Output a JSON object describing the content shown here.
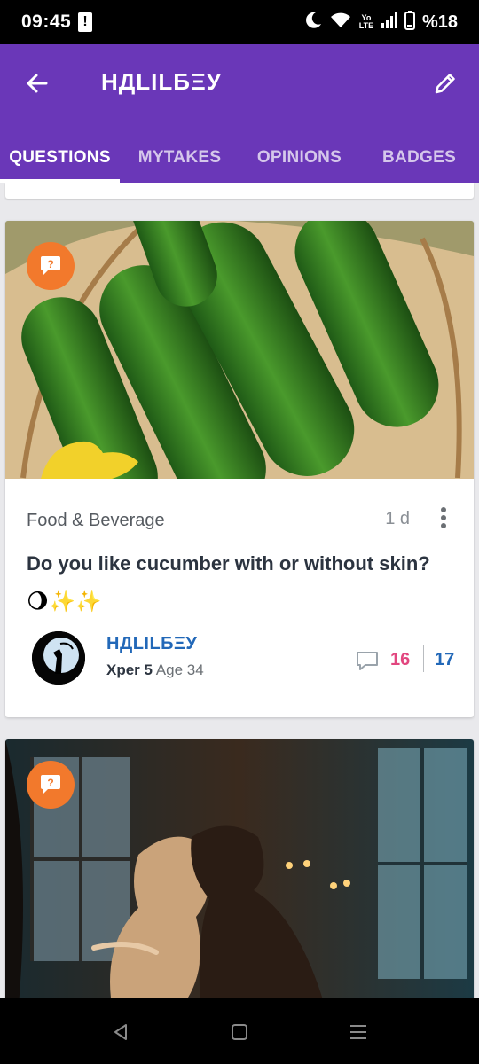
{
  "status_bar": {
    "time": "09:45",
    "alert_glyph": "!",
    "network": "Yo LTE",
    "battery": "%18",
    "icons": [
      "moon-icon",
      "wifi-icon",
      "lte-icon",
      "signal-icon",
      "battery-icon"
    ]
  },
  "app_bar": {
    "title": "НДLILБΞУ",
    "back_icon": "arrow-left-icon",
    "edit_icon": "pencil-icon"
  },
  "tabs": [
    {
      "label": "QUESTIONS",
      "active": true
    },
    {
      "label": "MYTAKES",
      "active": false
    },
    {
      "label": "OPINIONS",
      "active": false
    },
    {
      "label": "BADGES",
      "active": false
    }
  ],
  "cards": [
    {
      "image": "cucumbers-photo",
      "badge_icon": "question-bubble-icon",
      "category": "Food & Beverage",
      "time_ago": "1 d",
      "title": "Do you like cucumber with or without skin?",
      "emoji": "🌖✨✨",
      "author": {
        "name": "НДLILБΞУ",
        "xper": "Xper 5",
        "age": "Age 34"
      },
      "comments": "16",
      "likes": "17"
    },
    {
      "image": "couple-window-painting",
      "badge_icon": "question-bubble-icon"
    }
  ],
  "colors": {
    "app_bar": "#6a37b8",
    "badge": "#f2792c",
    "comments": "#e2467f",
    "likes": "#2268b8",
    "username": "#2268b8"
  },
  "nav_bar": {
    "buttons": [
      "back-triangle-icon",
      "home-square-icon",
      "recents-menu-icon"
    ]
  }
}
